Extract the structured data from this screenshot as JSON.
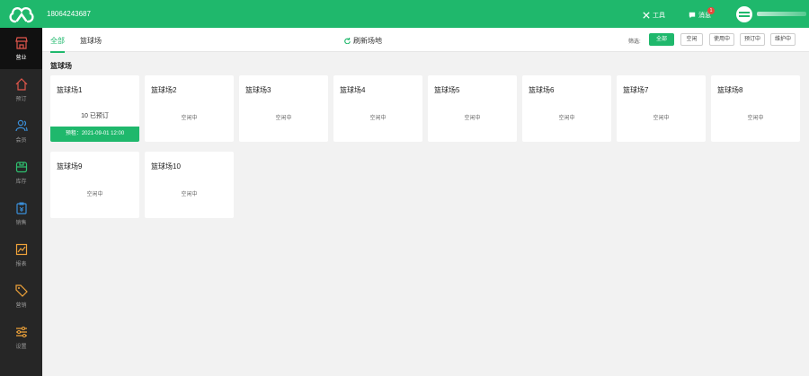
{
  "header": {
    "phone": "18064243687",
    "tools_label": "工具",
    "message_label": "消息",
    "message_badge": "1"
  },
  "sidebar": {
    "items": [
      {
        "label": "营业",
        "icon": "store-icon"
      },
      {
        "label": "预订",
        "icon": "home-icon"
      },
      {
        "label": "会员",
        "icon": "members-icon"
      },
      {
        "label": "库存",
        "icon": "inventory-icon"
      },
      {
        "label": "销售",
        "icon": "sales-icon"
      },
      {
        "label": "报表",
        "icon": "report-chart-icon"
      },
      {
        "label": "营销",
        "icon": "tag-icon"
      },
      {
        "label": "设置",
        "icon": "settings-sliders-icon"
      }
    ]
  },
  "filterbar": {
    "tabs": [
      "全部",
      "篮球场"
    ],
    "refresh_label": "刷新场地",
    "filter_label": "筛选:",
    "filters": [
      "全部",
      "空闲",
      "使用中",
      "预订中",
      "维护中"
    ]
  },
  "section": {
    "title": "篮球场"
  },
  "courts": [
    {
      "name": "篮球场1",
      "booked": "10 已预订",
      "reserve": "预租：2021-09-01 12:00"
    },
    {
      "name": "篮球场2",
      "status": "空闲中"
    },
    {
      "name": "篮球场3",
      "status": "空闲中"
    },
    {
      "name": "篮球场4",
      "status": "空闲中"
    },
    {
      "name": "篮球场5",
      "status": "空闲中"
    },
    {
      "name": "篮球场6",
      "status": "空闲中"
    },
    {
      "name": "篮球场7",
      "status": "空闲中"
    },
    {
      "name": "篮球场8",
      "status": "空闲中"
    },
    {
      "name": "篮球场9",
      "status": "空闲中"
    },
    {
      "name": "篮球场10",
      "status": "空闲中"
    }
  ],
  "colors": {
    "accent": "#1fb86c",
    "sidebar": "#262626",
    "nav_icon_active": "#e2574c",
    "nav_icon": "#f0a33a",
    "badge": "#e84a3c"
  }
}
